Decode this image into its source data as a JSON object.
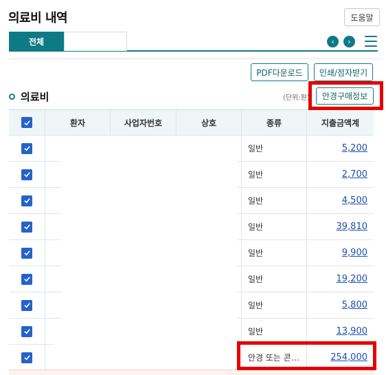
{
  "header": {
    "title": "의료비 내역",
    "help_label": "도움말"
  },
  "tabs": [
    {
      "label": "전체",
      "active": true
    },
    {
      "label": "",
      "active": false
    }
  ],
  "nav": {
    "prev_icon": "chevron-left-icon",
    "next_icon": "chevron-right-icon",
    "menu_icon": "hamburger-menu-icon"
  },
  "actions": {
    "pdf_label": "PDF다운로드",
    "print_label": "인쇄/점자받기"
  },
  "section": {
    "title": "의료비",
    "unit_label": "(단위:원)",
    "glasses_button": "안경구매정보"
  },
  "table": {
    "columns": [
      "환자",
      "사업자번호",
      "상호",
      "종류",
      "지출금액계"
    ],
    "rows": [
      {
        "kind": "일반",
        "amount": "5,200"
      },
      {
        "kind": "일반",
        "amount": "2,700"
      },
      {
        "kind": "일반",
        "amount": "4,500"
      },
      {
        "kind": "일반",
        "amount": "39,810"
      },
      {
        "kind": "일반",
        "amount": "9,900"
      },
      {
        "kind": "일반",
        "amount": "19,200"
      },
      {
        "kind": "일반",
        "amount": "5,800"
      },
      {
        "kind": "일반",
        "amount": "13,900"
      },
      {
        "kind": "안경 또는 콘…",
        "amount": "254,000"
      }
    ]
  },
  "colors": {
    "accent": "#0e7a86",
    "checkbox": "#2563c9",
    "highlight": "#e60000",
    "link": "#1a4fae"
  }
}
